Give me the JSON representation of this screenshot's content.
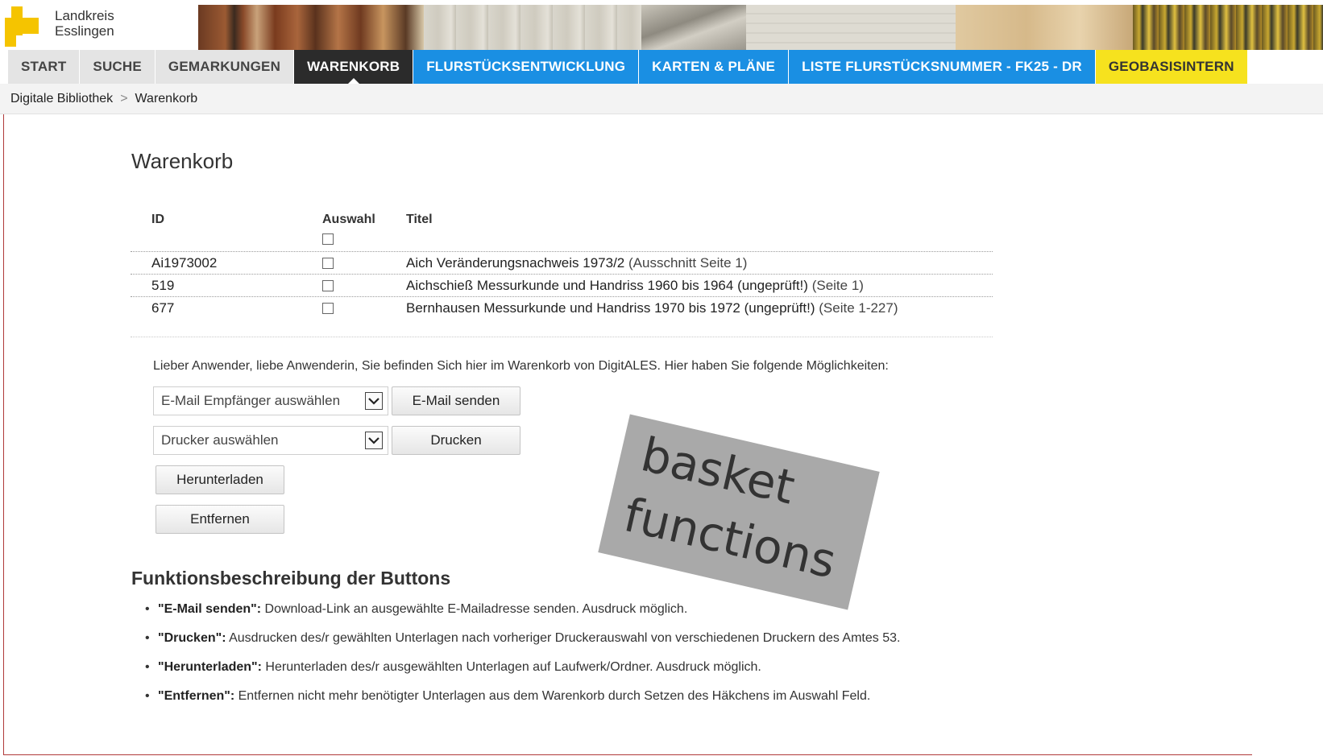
{
  "header": {
    "logo_line1": "Landkreis",
    "logo_line2": "Esslingen",
    "brand_color": "#f5c400"
  },
  "nav": {
    "items": [
      {
        "label": "START",
        "style": "grey"
      },
      {
        "label": "SUCHE",
        "style": "grey"
      },
      {
        "label": "GEMARKUNGEN",
        "style": "grey"
      },
      {
        "label": "WARENKORB",
        "style": "active"
      },
      {
        "label": "FLURSTÜCKSENTWICKLUNG",
        "style": "blue"
      },
      {
        "label": "KARTEN & PLÄNE",
        "style": "blue"
      },
      {
        "label": "LISTE FLURSTÜCKSNUMMER - FK25 - DR",
        "style": "blue"
      },
      {
        "label": "GEOBASISINTERN",
        "style": "yellow"
      }
    ],
    "colors": {
      "grey": "#e4e4e4",
      "active": "#2b2b2b",
      "blue": "#1a8fe3",
      "yellow": "#f6e21e"
    }
  },
  "breadcrumb": {
    "items": [
      "Digitale Bibliothek",
      "Warenkorb"
    ],
    "separator": ">"
  },
  "main": {
    "title": "Warenkorb",
    "table": {
      "headers": {
        "id": "ID",
        "select": "Auswahl",
        "title": "Titel"
      },
      "rows": [
        {
          "id": "Ai1973002",
          "title": "Aich Veränderungsnachweis 1973/2",
          "pages": "(Ausschnitt Seite 1)"
        },
        {
          "id": "519",
          "title": "Aichschieß Messurkunde und Handriss 1960 bis 1964 (ungeprüft!)",
          "pages": "(Seite 1)"
        },
        {
          "id": "677",
          "title": "Bernhausen Messurkunde und Handriss 1970 bis 1972 (ungeprüft!)",
          "pages": "(Seite 1-227)"
        }
      ]
    },
    "intro": "Lieber Anwender, liebe Anwenderin, Sie befinden Sich hier im Warenkorb von DigitALES. Hier haben Sie folgende Möglichkeiten:",
    "email_select": "E-Mail Empfänger auswählen",
    "email_button": "E-Mail senden",
    "printer_select": "Drucker auswählen",
    "print_button": "Drucken",
    "download_button": "Herunterladen",
    "remove_button": "Entfernen",
    "section_title": "Funktionsbeschreibung der Buttons",
    "descriptions": [
      {
        "term": "\"E-Mail senden\":",
        "text": " Download-Link an ausgewählte E-Mailadresse senden. Ausdruck möglich."
      },
      {
        "term": "\"Drucken\":",
        "text": " Ausdrucken des/r gewählten Unterlagen nach vorheriger Druckerauswahl von verschiedenen Druckern des Amtes 53."
      },
      {
        "term": "\"Herunterladen\":",
        "text": " Herunterladen des/r ausgewählten Unterlagen auf Laufwerk/Ordner. Ausdruck möglich."
      },
      {
        "term": "\"Entfernen\":",
        "text": " Entfernen nicht mehr benötigter Unterlagen aus dem Warenkorb durch Setzen des Häkchens im Auswahl Feld."
      }
    ]
  },
  "overlay": {
    "line1": "basket",
    "line2": "functions"
  }
}
